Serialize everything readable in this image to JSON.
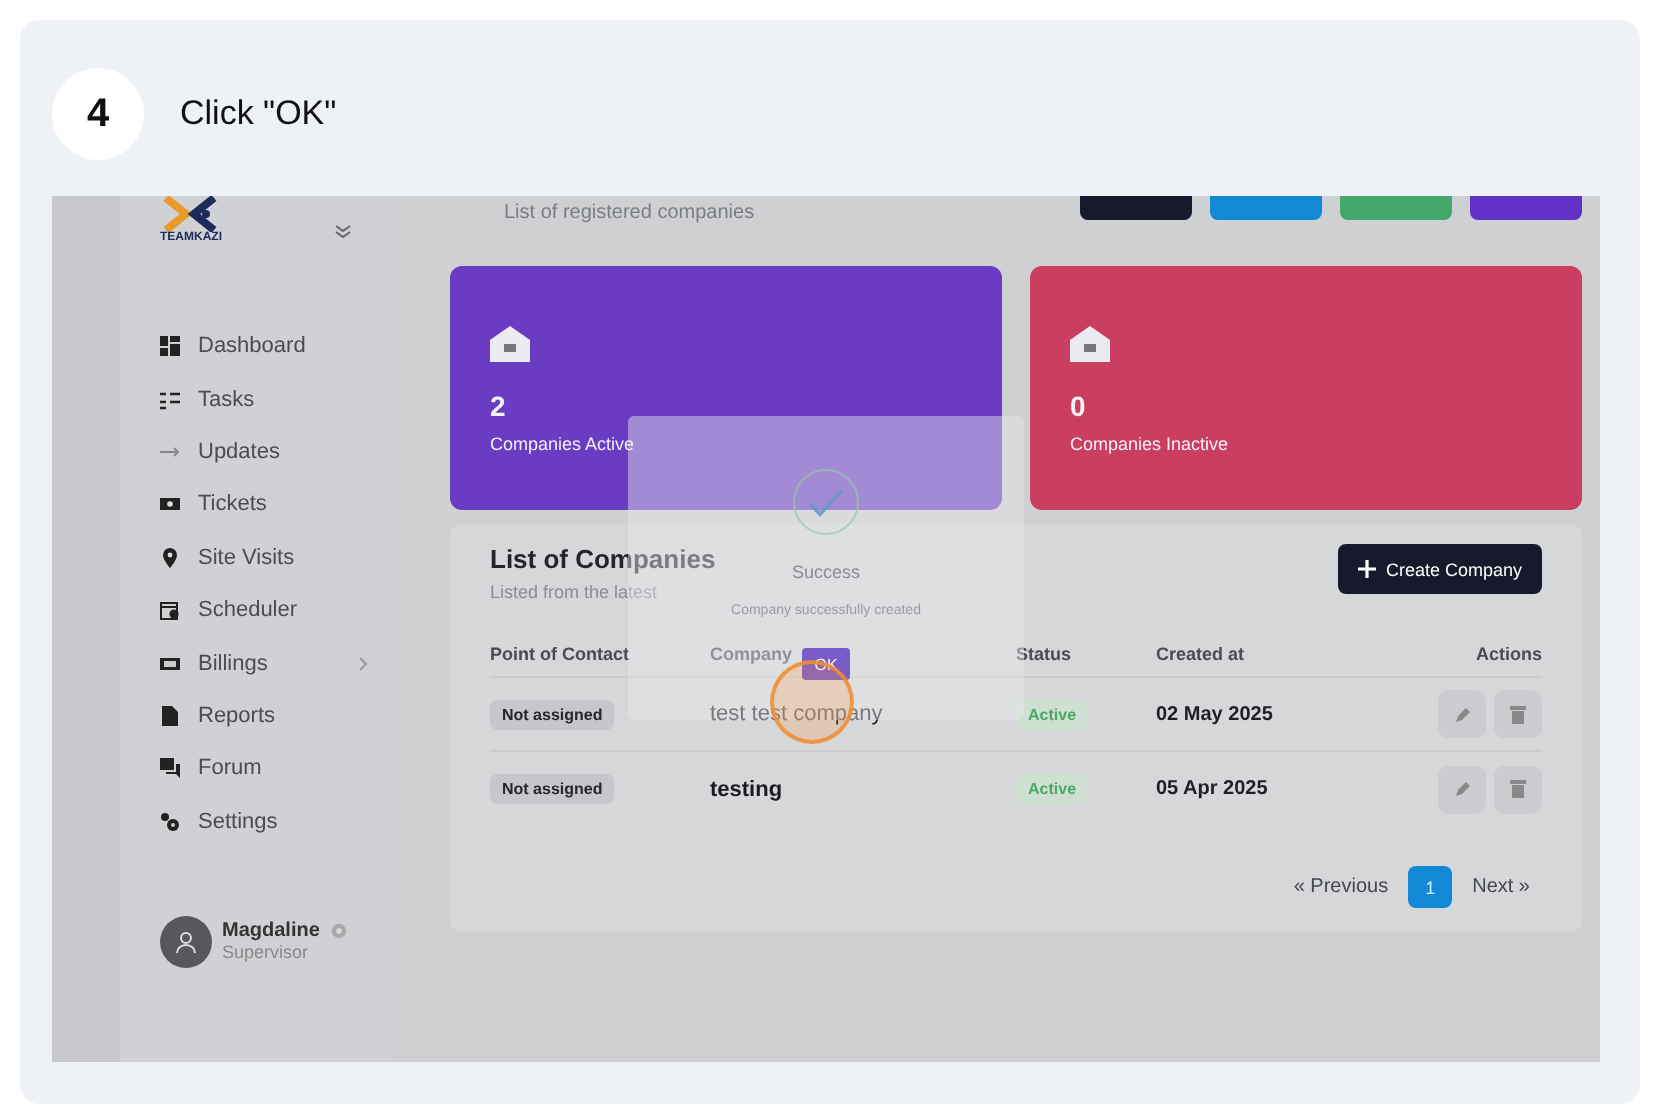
{
  "step": {
    "number": "4",
    "instruction": "Click \"OK\""
  },
  "screenshot": {
    "sidebar": {
      "logo_text": "TEAMKAZI",
      "items": [
        {
          "label": "Dashboard",
          "has_submenu": false
        },
        {
          "label": "Tasks",
          "has_submenu": false
        },
        {
          "label": "Updates",
          "has_submenu": false
        },
        {
          "label": "Tickets",
          "has_submenu": false
        },
        {
          "label": "Site Visits",
          "has_submenu": false
        },
        {
          "label": "Scheduler",
          "has_submenu": false
        },
        {
          "label": "Billings",
          "has_submenu": true
        },
        {
          "label": "Reports",
          "has_submenu": false
        },
        {
          "label": "Forum",
          "has_submenu": false
        },
        {
          "label": "Settings",
          "has_submenu": false
        }
      ],
      "user": {
        "name": "Magdaline",
        "role": "Supervisor"
      }
    },
    "header": {
      "subtitle": "List of registered companies",
      "action_buttons": [
        {
          "color": "#161a2c"
        },
        {
          "color": "#1289d6"
        },
        {
          "color": "#44a86a"
        },
        {
          "color": "#6330c8"
        }
      ]
    },
    "stat_cards": [
      {
        "value": "2",
        "label": "Companies Active",
        "color": "#6a3cc4"
      },
      {
        "value": "0",
        "label": "Companies Inactive",
        "color": "#ca3f60"
      }
    ],
    "table": {
      "title": "List of Companies",
      "subtitle": "Listed from the latest",
      "create_button": "Create Company",
      "columns": [
        "Point of Contact",
        "Company",
        "Status",
        "Created at",
        "Actions"
      ],
      "rows": [
        {
          "contact": "Not assigned",
          "company": "test test company",
          "status": "Active",
          "created": "02 May 2025"
        },
        {
          "contact": "Not assigned",
          "company": "testing",
          "status": "Active",
          "created": "05 Apr 2025"
        }
      ],
      "pagination": {
        "previous": "« Previous",
        "pages": [
          {
            "label": "1",
            "selected": true
          }
        ],
        "next": "Next »"
      }
    },
    "dialog": {
      "title": "Success",
      "message": "Company successfully created",
      "button": "OK"
    }
  }
}
